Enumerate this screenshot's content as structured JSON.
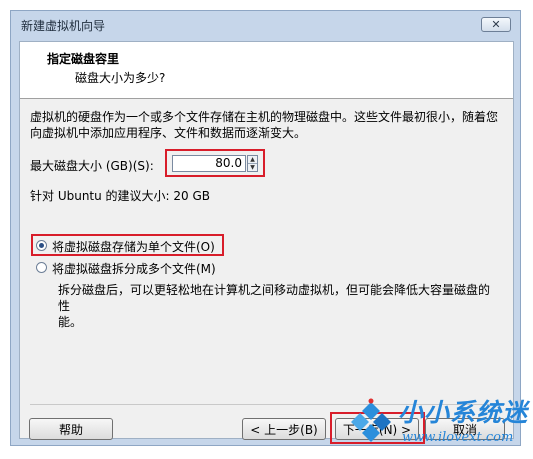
{
  "window": {
    "title": "新建虚拟机向导",
    "close_glyph": "✕"
  },
  "header": {
    "title": "指定磁盘容里",
    "subtitle": "磁盘大小为多少?"
  },
  "description_line1": "虚拟机的硬盘作为一个或多个文件存储在主机的物理磁盘中。这些文件最初很小，随着您",
  "description_line2": "向虚拟机中添加应用程序、文件和数据而逐渐变大。",
  "disk_size": {
    "label": "最大磁盘大小 (GB)(S):",
    "value": "80.0"
  },
  "recommended": "针对 Ubuntu 的建议大小: 20 GB",
  "options": [
    {
      "label": "将虚拟磁盘存储为单个文件(O)",
      "checked": true
    },
    {
      "label": "将虚拟磁盘拆分成多个文件(M)",
      "checked": false
    }
  ],
  "split_note_line1": "拆分磁盘后，可以更轻松地在计算机之间移动虚拟机，但可能会降低大容量磁盘的性",
  "split_note_line2": "能。",
  "buttons": {
    "help": "帮助",
    "back": "< 上一步(B)",
    "next": "下一步(N) >",
    "cancel": "取消"
  },
  "watermark": {
    "name": "小小系统迷",
    "url": "www.ilovext.com"
  },
  "colors": {
    "highlight": "#d81d2a",
    "watermark": "#2585d8",
    "window_frame": "#c6d6ea"
  }
}
